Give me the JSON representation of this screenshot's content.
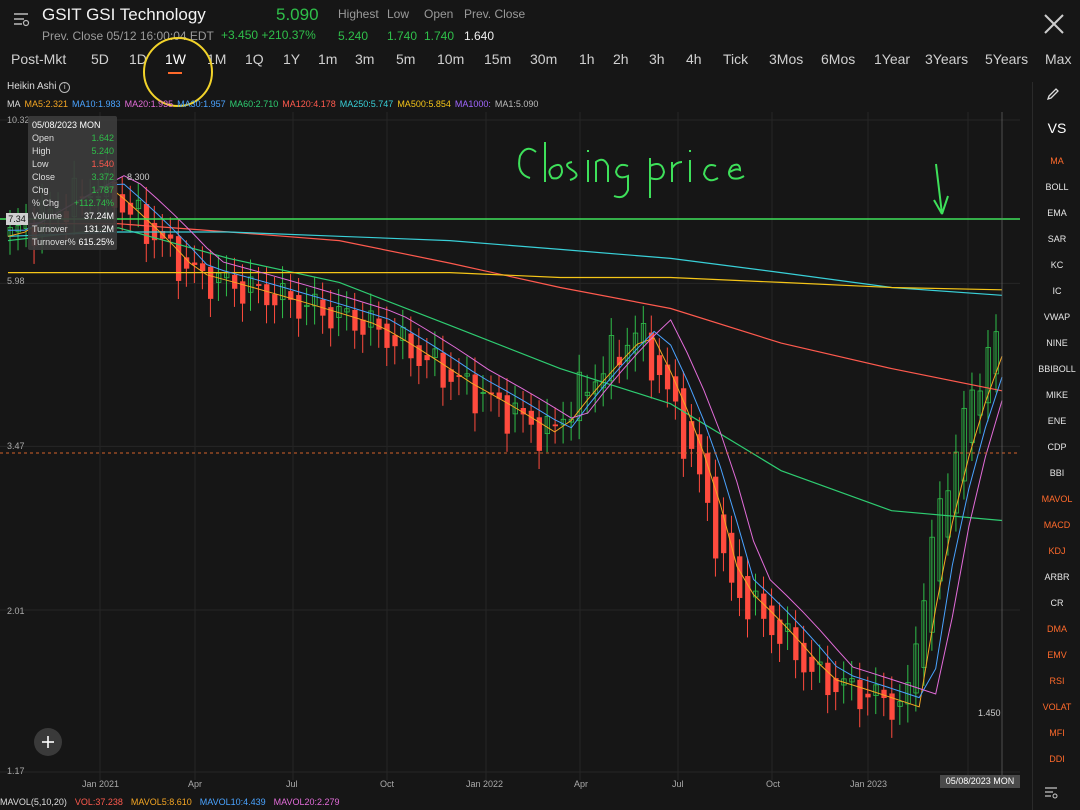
{
  "header": {
    "ticker": "GSIT GSI Technology",
    "price": "5.090",
    "prev_close_line": "Prev. Close 05/12 16:00:04 EDT",
    "change": "+3.450  +210.37%",
    "labels": {
      "highest": "Highest",
      "low": "Low",
      "open": "Open",
      "prev_close": "Prev. Close"
    },
    "values": {
      "highest": "5.240",
      "low": "1.740",
      "open": "1.740",
      "prev_close": "1.640"
    }
  },
  "tabs": [
    "Post-Mkt",
    "5D",
    "1D",
    "1W",
    "1M",
    "1Q",
    "1Y",
    "1m",
    "3m",
    "5m",
    "10m",
    "15m",
    "30m",
    "1h",
    "2h",
    "3h",
    "4h",
    "Tick",
    "3Mos",
    "6Mos",
    "1Year",
    "3Years",
    "5Years",
    "Max"
  ],
  "active_tab": "1W",
  "chart_label": "Heikin Ashi",
  "ma_items": [
    {
      "text": "MA",
      "color": "#dddddd"
    },
    {
      "text": "MA5:2.321",
      "color": "#f5a623"
    },
    {
      "text": "MA10:1.983",
      "color": "#4aa3ff"
    },
    {
      "text": "MA20:1.935",
      "color": "#e26cd9"
    },
    {
      "text": "MA30:1.957",
      "color": "#4aa3ff"
    },
    {
      "text": "MA60:2.710",
      "color": "#2ecc71"
    },
    {
      "text": "MA120:4.178",
      "color": "#ff5a4e"
    },
    {
      "text": "MA250:5.747",
      "color": "#39d0d8"
    },
    {
      "text": "MA500:5.854",
      "color": "#f5c518"
    },
    {
      "text": "MA1000:",
      "color": "#a066ff"
    },
    {
      "text": "MA1:5.090",
      "color": "#bbbbbb"
    }
  ],
  "y_axis": [
    "10.32",
    "5.98",
    "3.47",
    "2.01",
    "1.17"
  ],
  "x_axis": [
    "Jan 2021",
    "Apr",
    "Jul",
    "Oct",
    "Jan 2022",
    "Apr",
    "Jul",
    "Oct",
    "Jan 2023"
  ],
  "tooltip": {
    "date": "05/08/2023 MON",
    "rows": [
      {
        "label": "Open",
        "value": "1.642",
        "color": "#2fbf4a"
      },
      {
        "label": "High",
        "value": "5.240",
        "color": "#2fbf4a"
      },
      {
        "label": "Low",
        "value": "1.540",
        "color": "#ff5a4e"
      },
      {
        "label": "Close",
        "value": "3.372",
        "color": "#2fbf4a"
      },
      {
        "label": "Chg",
        "value": "1.787",
        "color": "#2fbf4a"
      },
      {
        "label": "% Chg",
        "value": "+112.74%",
        "color": "#2fbf4a"
      },
      {
        "label": "Volume",
        "value": "37.24M",
        "color": "#ffffff"
      },
      {
        "label": "Turnover",
        "value": "131.2M",
        "color": "#ffffff"
      },
      {
        "label": "Turnover%",
        "value": "615.25%",
        "color": "#ffffff"
      }
    ]
  },
  "annotations": {
    "high_marker": "8.300",
    "low_marker": "1.450",
    "price_tag": "7.34",
    "date_badge": "05/08/2023 MON"
  },
  "handwriting": "Closing price",
  "sidebar": [
    {
      "label": "VS",
      "color": "#ffffff"
    },
    {
      "label": "MA",
      "color": "#ff6a2b"
    },
    {
      "label": "BOLL",
      "color": "#e6e6e6"
    },
    {
      "label": "EMA",
      "color": "#e6e6e6"
    },
    {
      "label": "SAR",
      "color": "#e6e6e6"
    },
    {
      "label": "KC",
      "color": "#e6e6e6"
    },
    {
      "label": "IC",
      "color": "#e6e6e6"
    },
    {
      "label": "VWAP",
      "color": "#e6e6e6"
    },
    {
      "label": "NINE",
      "color": "#e6e6e6"
    },
    {
      "label": "BBIBOLL",
      "color": "#e6e6e6"
    },
    {
      "label": "MIKE",
      "color": "#e6e6e6"
    },
    {
      "label": "ENE",
      "color": "#e6e6e6"
    },
    {
      "label": "CDP",
      "color": "#e6e6e6"
    },
    {
      "label": "BBI",
      "color": "#e6e6e6"
    },
    {
      "label": "MAVOL",
      "color": "#ff6a2b"
    },
    {
      "label": "MACD",
      "color": "#ff6a2b"
    },
    {
      "label": "KDJ",
      "color": "#ff6a2b"
    },
    {
      "label": "ARBR",
      "color": "#e6e6e6"
    },
    {
      "label": "CR",
      "color": "#e6e6e6"
    },
    {
      "label": "DMA",
      "color": "#ff6a2b"
    },
    {
      "label": "EMV",
      "color": "#ff6a2b"
    },
    {
      "label": "RSI",
      "color": "#ff6a2b"
    },
    {
      "label": "VOLAT",
      "color": "#ff6a2b"
    },
    {
      "label": "MFI",
      "color": "#ff6a2b"
    },
    {
      "label": "DDI",
      "color": "#ff6a2b"
    }
  ],
  "bottom_bar": [
    {
      "text": "MAVOL(5,10,20)",
      "color": "#dddddd"
    },
    {
      "text": "VOL:37.238",
      "color": "#ff5a4e"
    },
    {
      "text": "MAVOL5:8.610",
      "color": "#f5a623"
    },
    {
      "text": "MAVOL10:4.439",
      "color": "#4aa3ff"
    },
    {
      "text": "MAVOL20:2.279",
      "color": "#e26cd9"
    }
  ],
  "colors": {
    "up": "#2fbf4a",
    "down": "#ff4b3e",
    "accent": "#ff6a2b",
    "highlight": "#f2d32a",
    "handwriting": "#3ee05a"
  },
  "chart_data": {
    "type": "line",
    "title": "",
    "y_ticks": [
      10.32,
      5.98,
      3.47,
      2.01,
      1.17
    ],
    "ylim": [
      1.17,
      10.32
    ],
    "y_scale": "log",
    "x": [
      "Jan 2021",
      "Apr",
      "Jul",
      "Oct",
      "Jan 2022",
      "Apr",
      "Jul",
      "Oct",
      "Jan 2023"
    ],
    "series": [
      {
        "name": "MA60",
        "values": [
          6.9,
          7.2,
          6.5,
          6.0,
          5.2,
          4.5,
          4.0,
          3.2,
          2.8,
          2.71
        ]
      },
      {
        "name": "MA120",
        "values": [
          7.3,
          7.3,
          7.1,
          6.9,
          6.4,
          5.9,
          5.5,
          4.9,
          4.5,
          4.178
        ]
      },
      {
        "name": "MA250",
        "values": [
          7.0,
          7.1,
          7.1,
          7.0,
          6.9,
          6.7,
          6.5,
          6.2,
          5.9,
          5.747
        ]
      },
      {
        "name": "MA500",
        "values": [
          6.2,
          6.2,
          6.2,
          6.2,
          6.2,
          6.1,
          6.1,
          6.0,
          5.9,
          5.854
        ]
      }
    ],
    "close_approx": [
      7.0,
      8.3,
      6.2,
      5.7,
      5.2,
      4.3,
      3.6,
      5.1,
      2.2,
      1.6,
      1.45,
      5.09
    ]
  }
}
